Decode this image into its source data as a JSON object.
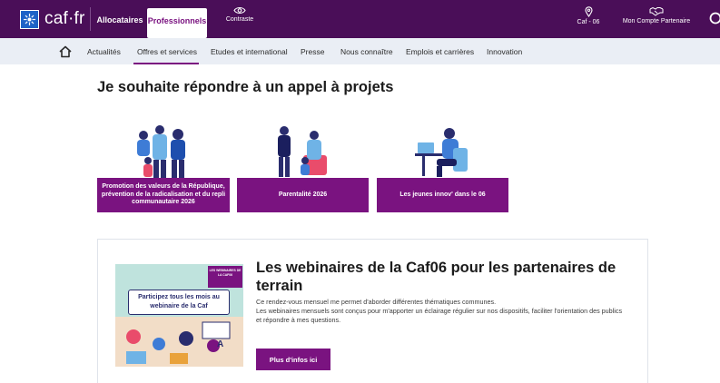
{
  "header": {
    "logo_text": "caf·fr",
    "tabs": [
      {
        "label": "Allocataires"
      },
      {
        "label": "Professionnels",
        "active": true
      }
    ],
    "contraste_label": "Contraste",
    "location_label": "Caf - 06",
    "account_label": "Mon Compte Partenaire",
    "brand_color": "#4a0e58",
    "accent_color": "#7a1380"
  },
  "subnav": {
    "items": [
      {
        "label": "Actualités"
      },
      {
        "label": "Offres et services",
        "active": true
      },
      {
        "label": "Etudes et international"
      },
      {
        "label": "Presse"
      },
      {
        "label": "Nous connaître"
      },
      {
        "label": "Emplois et carrières"
      },
      {
        "label": "Innovation"
      }
    ]
  },
  "main": {
    "title": "Je souhaite répondre à un appel à projets",
    "cards": [
      {
        "label": "Promotion des valeurs de la République, prévention de la radicalisation et du repli communautaire 2026"
      },
      {
        "label": "Parentalité 2026"
      },
      {
        "label": "Les jeunes innov' dans le 06"
      }
    ]
  },
  "webinaire": {
    "thumb_tag": "LES WEBINAIRES DE LA CAF06",
    "thumb_caption": "Participez tous les mois au webinaire de la Caf",
    "title": "Les webinaires de la Caf06 pour les partenaires de terrain",
    "paragraph_1": "Ce rendez-vous mensuel me permet d'aborder différentes thématiques communes.",
    "paragraph_2": "Les webinaires mensuels sont conçus pour m'apporter un éclairage régulier sur nos dispositifs, faciliter l'orientation des publics et répondre à mes questions.",
    "button_label": "Plus d'infos ici"
  }
}
